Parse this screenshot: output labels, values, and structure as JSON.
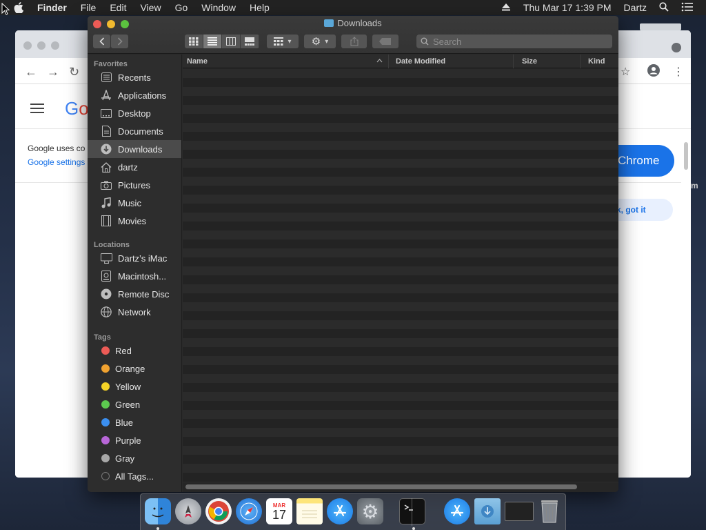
{
  "menubar": {
    "items": [
      "Finder",
      "File",
      "Edit",
      "View",
      "Go",
      "Window",
      "Help"
    ],
    "datetime": "Thu Mar 17  1:39 PM",
    "user": "Dartz"
  },
  "finder": {
    "title": "Downloads",
    "search_placeholder": "Search",
    "sidebar": {
      "favorites_label": "Favorites",
      "favorites": [
        {
          "label": "Recents",
          "icon": "recents-icon"
        },
        {
          "label": "Applications",
          "icon": "applications-icon"
        },
        {
          "label": "Desktop",
          "icon": "desktop-icon"
        },
        {
          "label": "Documents",
          "icon": "documents-icon"
        },
        {
          "label": "Downloads",
          "icon": "downloads-icon",
          "selected": true
        },
        {
          "label": "dartz",
          "icon": "home-icon"
        },
        {
          "label": "Pictures",
          "icon": "pictures-icon"
        },
        {
          "label": "Music",
          "icon": "music-icon"
        },
        {
          "label": "Movies",
          "icon": "movies-icon"
        }
      ],
      "locations_label": "Locations",
      "locations": [
        {
          "label": "Dartz’s iMac",
          "icon": "imac-icon"
        },
        {
          "label": "Macintosh...",
          "icon": "disk-icon"
        },
        {
          "label": "Remote Disc",
          "icon": "remote-disc-icon"
        },
        {
          "label": "Network",
          "icon": "network-icon"
        }
      ],
      "tags_label": "Tags",
      "tags": [
        {
          "label": "Red",
          "color": "#ec5b56"
        },
        {
          "label": "Orange",
          "color": "#f0a230"
        },
        {
          "label": "Yellow",
          "color": "#f5d327"
        },
        {
          "label": "Green",
          "color": "#5cc94f"
        },
        {
          "label": "Blue",
          "color": "#3b8ff0"
        },
        {
          "label": "Purple",
          "color": "#b866d8"
        },
        {
          "label": "Gray",
          "color": "#a8a8a8"
        }
      ],
      "all_tags": "All Tags..."
    },
    "columns": [
      "Name",
      "Date Modified",
      "Size",
      "Kind"
    ]
  },
  "chrome_bg": {
    "logo_text": "Go",
    "cookie_text": "Google uses co",
    "settings_link": "Google settings",
    "chrome_button": "Chrome",
    "ok_button": "k, got it",
    "side_letter": "m"
  },
  "dock": {
    "apps": [
      "finder",
      "launchpad",
      "chrome",
      "safari",
      "calendar",
      "notes",
      "app-store",
      "system-preferences",
      "terminal",
      "app-store-2",
      "downloads-folder",
      "window-thumbnail",
      "trash"
    ],
    "calendar_month": "MAR",
    "calendar_day": "17"
  }
}
